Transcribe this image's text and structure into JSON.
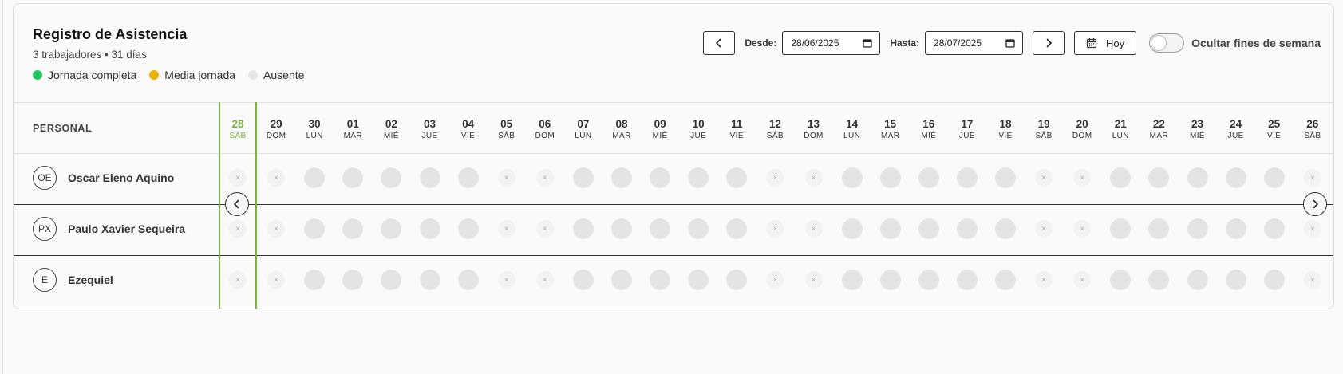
{
  "header": {
    "title": "Registro de Asistencia",
    "subtitle": "3 trabajadores • 31 días",
    "legend": [
      {
        "label": "Jornada completa",
        "color": "#22c55e"
      },
      {
        "label": "Media jornada",
        "color": "#eab308"
      },
      {
        "label": "Ausente",
        "color": "#e5e7eb"
      }
    ]
  },
  "controls": {
    "desde_label": "Desde:",
    "desde_value": "28/06/2025",
    "hasta_label": "Hasta:",
    "hasta_value": "28/07/2025",
    "today_label": "Hoy",
    "toggle_label": "Ocultar fines de semana",
    "toggle_on": false
  },
  "grid": {
    "personal_header": "PERSONAL",
    "days": [
      {
        "num": "28",
        "wd": "SÁB",
        "weekend": true,
        "current": true
      },
      {
        "num": "29",
        "wd": "DOM",
        "weekend": true
      },
      {
        "num": "30",
        "wd": "LUN",
        "weekend": false
      },
      {
        "num": "01",
        "wd": "MAR",
        "weekend": false
      },
      {
        "num": "02",
        "wd": "MIÉ",
        "weekend": false
      },
      {
        "num": "03",
        "wd": "JUE",
        "weekend": false
      },
      {
        "num": "04",
        "wd": "VIE",
        "weekend": false
      },
      {
        "num": "05",
        "wd": "SÁB",
        "weekend": true
      },
      {
        "num": "06",
        "wd": "DOM",
        "weekend": true
      },
      {
        "num": "07",
        "wd": "LUN",
        "weekend": false
      },
      {
        "num": "08",
        "wd": "MAR",
        "weekend": false
      },
      {
        "num": "09",
        "wd": "MIÉ",
        "weekend": false
      },
      {
        "num": "10",
        "wd": "JUE",
        "weekend": false
      },
      {
        "num": "11",
        "wd": "VIE",
        "weekend": false
      },
      {
        "num": "12",
        "wd": "SÁB",
        "weekend": true
      },
      {
        "num": "13",
        "wd": "DOM",
        "weekend": true
      },
      {
        "num": "14",
        "wd": "LUN",
        "weekend": false
      },
      {
        "num": "15",
        "wd": "MAR",
        "weekend": false
      },
      {
        "num": "16",
        "wd": "MIÉ",
        "weekend": false
      },
      {
        "num": "17",
        "wd": "JUE",
        "weekend": false
      },
      {
        "num": "18",
        "wd": "VIE",
        "weekend": false
      },
      {
        "num": "19",
        "wd": "SÁB",
        "weekend": true
      },
      {
        "num": "20",
        "wd": "DOM",
        "weekend": true
      },
      {
        "num": "21",
        "wd": "LUN",
        "weekend": false
      },
      {
        "num": "22",
        "wd": "MAR",
        "weekend": false
      },
      {
        "num": "23",
        "wd": "MIÉ",
        "weekend": false
      },
      {
        "num": "24",
        "wd": "JUE",
        "weekend": false
      },
      {
        "num": "25",
        "wd": "VIE",
        "weekend": false
      },
      {
        "num": "26",
        "wd": "SÁB",
        "weekend": true
      }
    ],
    "off_symbol": "×",
    "workers": [
      {
        "initials": "OE",
        "name": "Oscar Eleno Aquino"
      },
      {
        "initials": "PX",
        "name": "Paulo Xavier Sequeira"
      },
      {
        "initials": "E",
        "name": "Ezequiel"
      }
    ]
  },
  "colors": {
    "accent": "#7cb342",
    "cell_full": "#e4e4e7",
    "cell_off": "#f2f2f3"
  }
}
